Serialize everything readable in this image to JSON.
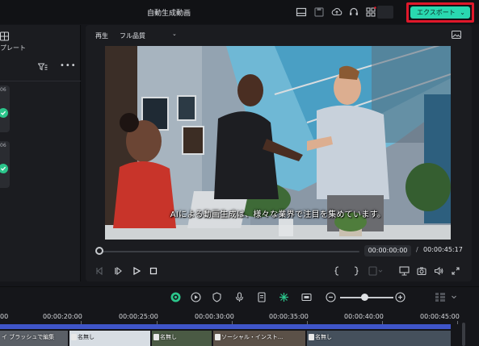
{
  "window": {
    "title": "自動生成動画"
  },
  "header": {
    "export_label": "エクスポート",
    "export_chevron": "⌄"
  },
  "left_panel": {
    "tab_label": "プレート",
    "card_numbers": [
      "06",
      "06"
    ],
    "more_label": "•••"
  },
  "preview": {
    "mode_label": "再生",
    "quality": "フル品質",
    "quality_chevron": "⌄",
    "subtitle": "AIによる動画生成は、様々な業界で注目を集めています。",
    "timecode_current": "00:00:00:00",
    "timecode_separator": "/",
    "timecode_total": "00:00:45:17",
    "playhead_progress": 0.0
  },
  "toolbar": {
    "zoom_level": 0.4
  },
  "timeline": {
    "ruler": [
      "00",
      "00:00:20:00",
      "00:00:25:00",
      "00:00:30:00",
      "00:00:35:00",
      "00:00:40:00",
      "00:00:45:00"
    ],
    "clips": [
      {
        "label": "イ ブラッシュで編集"
      },
      {
        "label": "名無し"
      },
      {
        "label": "名無し"
      },
      {
        "label": "ソーシャル・インスト..."
      },
      {
        "label": "名無し"
      }
    ]
  },
  "colors": {
    "accent": "#29d8b0",
    "highlight_border": "#e0182a",
    "timeline_bar": "#3f55c9",
    "check": "#2bc58b"
  }
}
